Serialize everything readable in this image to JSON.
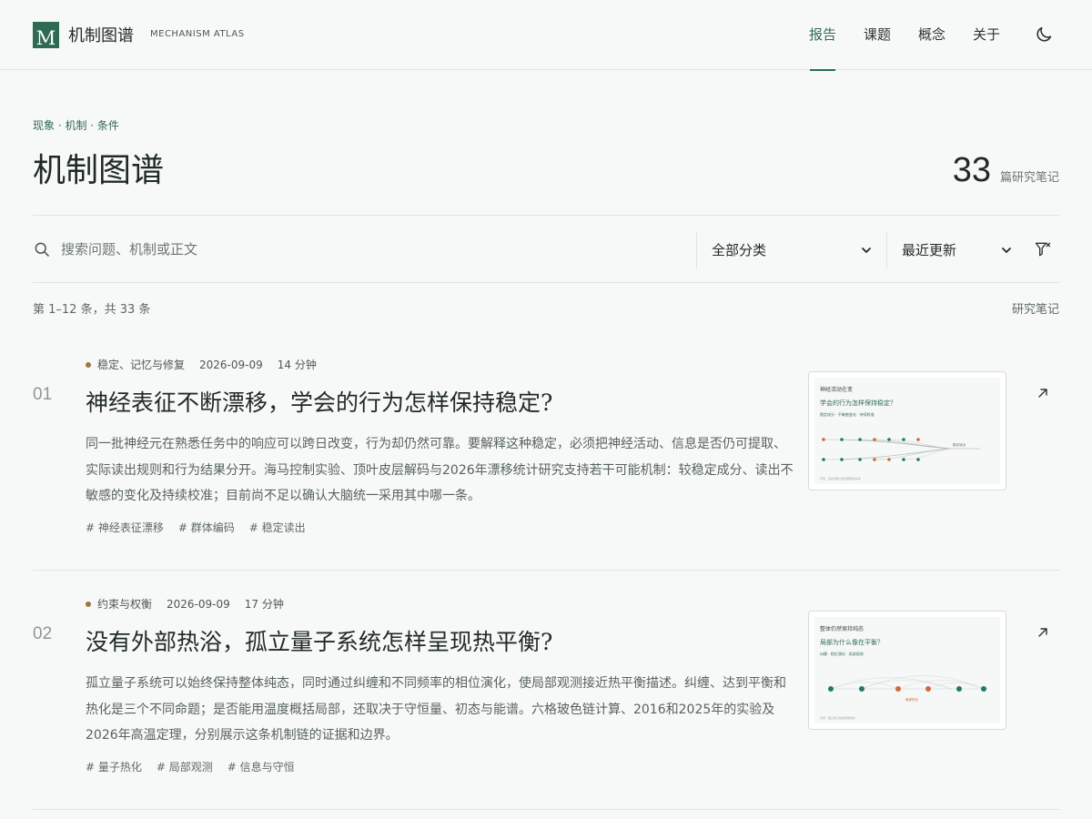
{
  "header": {
    "logo_letter": "M",
    "brand_name": "机制图谱",
    "brand_sub": "MECHANISM ATLAS",
    "nav": [
      {
        "label": "报告",
        "active": true
      },
      {
        "label": "课题",
        "active": false
      },
      {
        "label": "概念",
        "active": false
      },
      {
        "label": "关于",
        "active": false
      }
    ],
    "theme_icon": "moon-icon"
  },
  "hero": {
    "eyebrow": "现象 · 机制 · 条件",
    "title": "机制图谱",
    "count": "33",
    "count_label": "篇研究笔记"
  },
  "toolbar": {
    "search_placeholder": "搜索问题、机制或正文",
    "category_selected": "全部分类",
    "sort_selected": "最近更新"
  },
  "results": {
    "range_text": "第 1–12 条，共 33 条",
    "label": "研究笔记"
  },
  "articles": [
    {
      "index": "01",
      "category": "稳定、记忆与修复",
      "date": "2026-09-09",
      "read_time": "14 分钟",
      "title": "神经表征不断漂移，学会的行为怎样保持稳定?",
      "excerpt": "同一批神经元在熟悉任务中的响应可以跨日改变，行为却仍然可靠。要解释这种稳定，必须把神经活动、信息是否仍可提取、实际读出规则和行为结果分开。海马控制实验、顶叶皮层解码与2026年漂移统计研究支持若干可能机制：较稳定成分、读出不敏感的变化及持续校准；目前尚不足以确认大脑统一采用其中哪一条。",
      "tags": [
        "# 神经表征漂移",
        "# 群体编码",
        "# 稳定读出"
      ],
      "thumb": {
        "line1": "神经活动在变",
        "line2": "学会的行为怎样保持稳定？",
        "line3": "稳定成分 · 不敏感变化 · 持续校准",
        "end_label": "稳定读出",
        "foot": "示意 · 表征漂移与读出规则的关系"
      }
    },
    {
      "index": "02",
      "category": "约束与权衡",
      "date": "2026-09-09",
      "read_time": "17 分钟",
      "title": "没有外部热浴，孤立量子系统怎样呈现热平衡?",
      "excerpt": "孤立量子系统可以始终保持整体纯态，同时通过纠缠和不同频率的相位演化，使局部观测接近热平衡描述。纠缠、达到平衡和热化是三个不同命题；是否能用温度概括局部，还取决于守恒量、初态与能谱。六格玻色链计算、2016和2025年的实验及2026年高温定理，分别展示这条机制链的证据和边界。",
      "tags": [
        "# 量子热化",
        "# 局部观测",
        "# 信息与守恒"
      ],
      "thumb": {
        "line1": "整体仍然保持纯态",
        "line2": "局部为什么像在平衡？",
        "line3": "纠缠 · 相位演化 · 局部观测",
        "end_label": "局部热化",
        "foot": "示意 · 孤立量子链的局部热化"
      }
    }
  ],
  "colors": {
    "accent": "#2f6b53",
    "category_dot": "#a0763a",
    "thumb_orange": "#d0683e",
    "thumb_teal": "#1e7a6e"
  }
}
